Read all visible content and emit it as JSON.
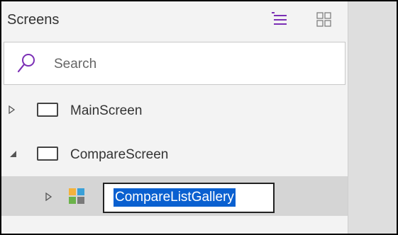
{
  "panel": {
    "title": "Screens",
    "header_icons": [
      "tree-view-icon",
      "grid-view-icon"
    ],
    "accent_color": "#7b2fb5"
  },
  "search": {
    "placeholder": "Search",
    "icon": "search-icon"
  },
  "tree": {
    "items": [
      {
        "label": "MainScreen",
        "expanded": false,
        "type": "screen"
      },
      {
        "label": "CompareScreen",
        "expanded": true,
        "type": "screen"
      },
      {
        "label": "CompareListGallery",
        "expanded": false,
        "type": "gallery",
        "editing": true,
        "selected": true
      }
    ]
  },
  "colors": {
    "gallery_icon": [
      "#f3b23c",
      "#3aa0d8",
      "#6bb34a",
      "#7a7a7a"
    ],
    "selection": "#0a60d0"
  }
}
